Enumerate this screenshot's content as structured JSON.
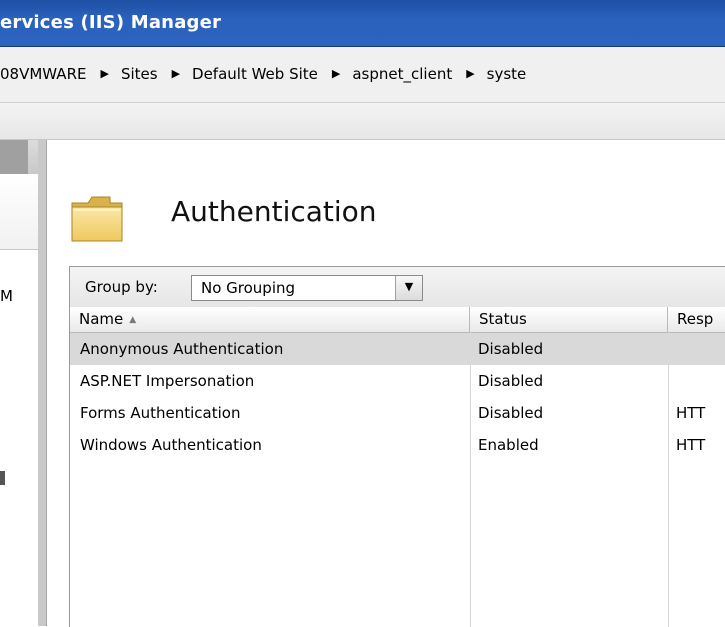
{
  "window": {
    "title": "ervices (IIS) Manager"
  },
  "breadcrumb": {
    "items": [
      "08VMWARE",
      "Sites",
      "Default Web Site",
      "aspnet_client",
      "syste"
    ]
  },
  "left_panel": {
    "label": "M"
  },
  "page": {
    "title": "Authentication",
    "icon": "folder-icon"
  },
  "groupby": {
    "label": "Group by:",
    "value": "No Grouping"
  },
  "table": {
    "columns": [
      "Name",
      "Status",
      "Resp"
    ],
    "rows": [
      {
        "name": "Anonymous Authentication",
        "status": "Disabled",
        "resp": ""
      },
      {
        "name": "ASP.NET Impersonation",
        "status": "Disabled",
        "resp": ""
      },
      {
        "name": "Forms Authentication",
        "status": "Disabled",
        "resp": "HTT"
      },
      {
        "name": "Windows Authentication",
        "status": "Enabled",
        "resp": "HTT"
      }
    ],
    "selected_row": 0
  }
}
